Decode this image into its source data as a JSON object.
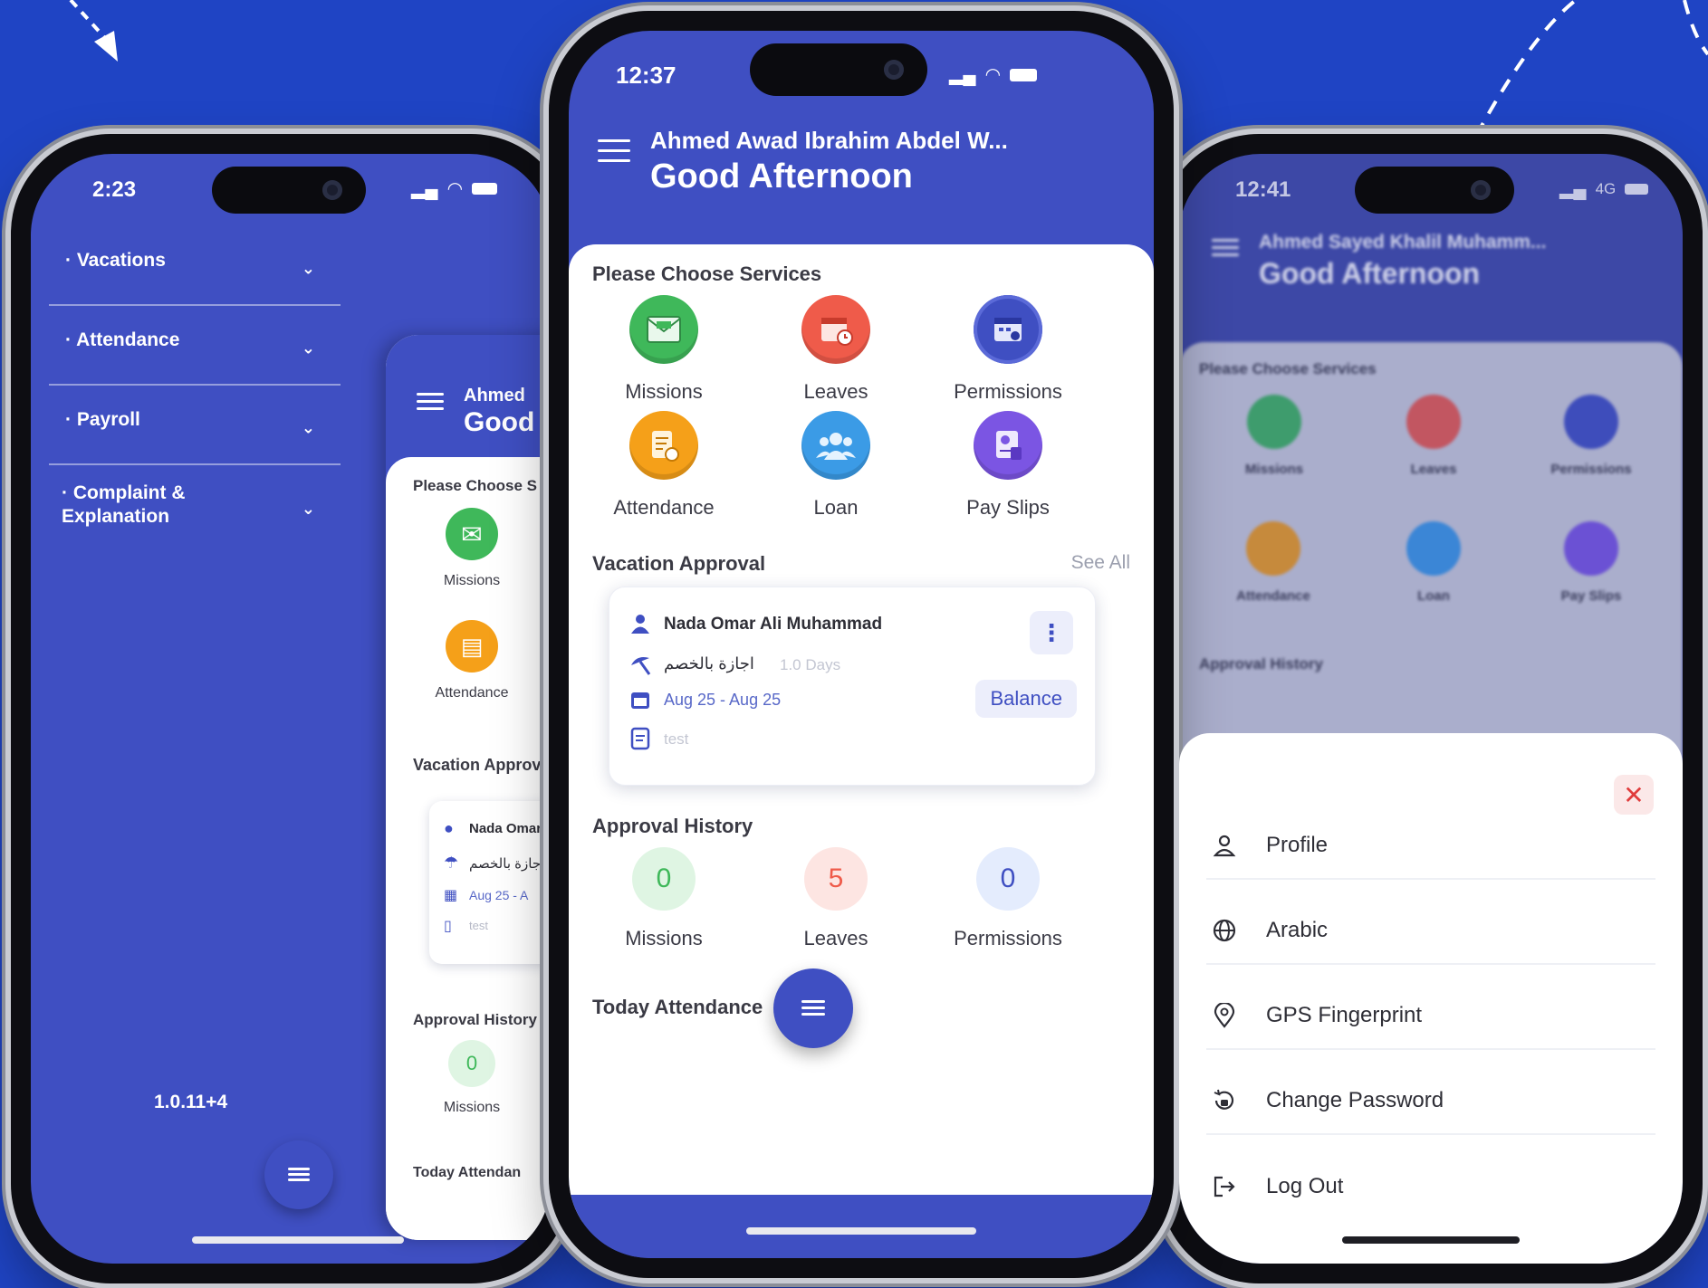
{
  "colors": {
    "background": "#1f44c4",
    "primary": "#3f4fc2",
    "missions_green": "#3fb85a",
    "leaves_red": "#ef5b4a",
    "permissions_blue": "#3f4fc2",
    "attendance_orange": "#f5a019",
    "loan_blue": "#3b9be6",
    "payslips_purple": "#7b55e3"
  },
  "left_phone": {
    "status_time": "2:23",
    "drawer": [
      {
        "label": "Vacations"
      },
      {
        "label": "Attendance"
      },
      {
        "label": "Payroll"
      },
      {
        "label": "Complaint &",
        "label2": "Explanation"
      }
    ],
    "version": "1.0.11+4",
    "peek": {
      "user_name": "Ahmed",
      "greeting": "Good",
      "services_title": "Please Choose S",
      "service_missions": "Missions",
      "service_attendance": "Attendance",
      "vacation_title": "Vacation Approv",
      "card_name": "Nada Omar",
      "card_type": "اجازة بالخصم",
      "card_dates": "Aug 25 - A",
      "card_note": "test",
      "history_title": "Approval History",
      "history_missions_count": "0",
      "history_missions_label": "Missions",
      "today_title": "Today Attendan"
    }
  },
  "center_phone": {
    "status_time": "12:37",
    "user_name": "Ahmed Awad Ibrahim Abdel W...",
    "greeting": "Good Afternoon",
    "services_title": "Please Choose Services",
    "services": [
      {
        "label": "Missions",
        "icon": "envelope-icon"
      },
      {
        "label": "Leaves",
        "icon": "calendar-clock-icon"
      },
      {
        "label": "Permissions",
        "icon": "calendar-settings-icon"
      },
      {
        "label": "Attendance",
        "icon": "document-clock-icon"
      },
      {
        "label": "Loan",
        "icon": "group-icon"
      },
      {
        "label": "Pay Slips",
        "icon": "payslip-icon"
      }
    ],
    "vacation_title": "Vacation Approval",
    "see_all": "See All",
    "card": {
      "name": "Nada Omar Ali Muhammad",
      "type": "اجازة بالخصم",
      "days": "1.0 Days",
      "dates": "Aug 25 - Aug 25",
      "note": "test",
      "balance": "Balance"
    },
    "history_title": "Approval History",
    "history": [
      {
        "count": "0",
        "label": "Missions"
      },
      {
        "count": "5",
        "label": "Leaves"
      },
      {
        "count": "0",
        "label": "Permissions"
      }
    ],
    "today_title": "Today Attendance"
  },
  "right_phone": {
    "status_time": "12:41",
    "status_network": "4G",
    "user_name": "Ahmed Sayed Khalil Muhamm...",
    "greeting": "Good Afternoon",
    "services_title": "Please Choose Services",
    "services": [
      "Missions",
      "Leaves",
      "Permissions",
      "Attendance",
      "Loan",
      "Pay Slips"
    ],
    "history_title": "Approval History",
    "menu": [
      {
        "label": "Profile",
        "icon": "person-icon"
      },
      {
        "label": "Arabic",
        "icon": "globe-icon"
      },
      {
        "label": "GPS Fingerprint",
        "icon": "location-pin-icon"
      },
      {
        "label": "Change Password",
        "icon": "password-reset-icon"
      },
      {
        "label": "Log Out",
        "icon": "logout-icon"
      }
    ]
  }
}
